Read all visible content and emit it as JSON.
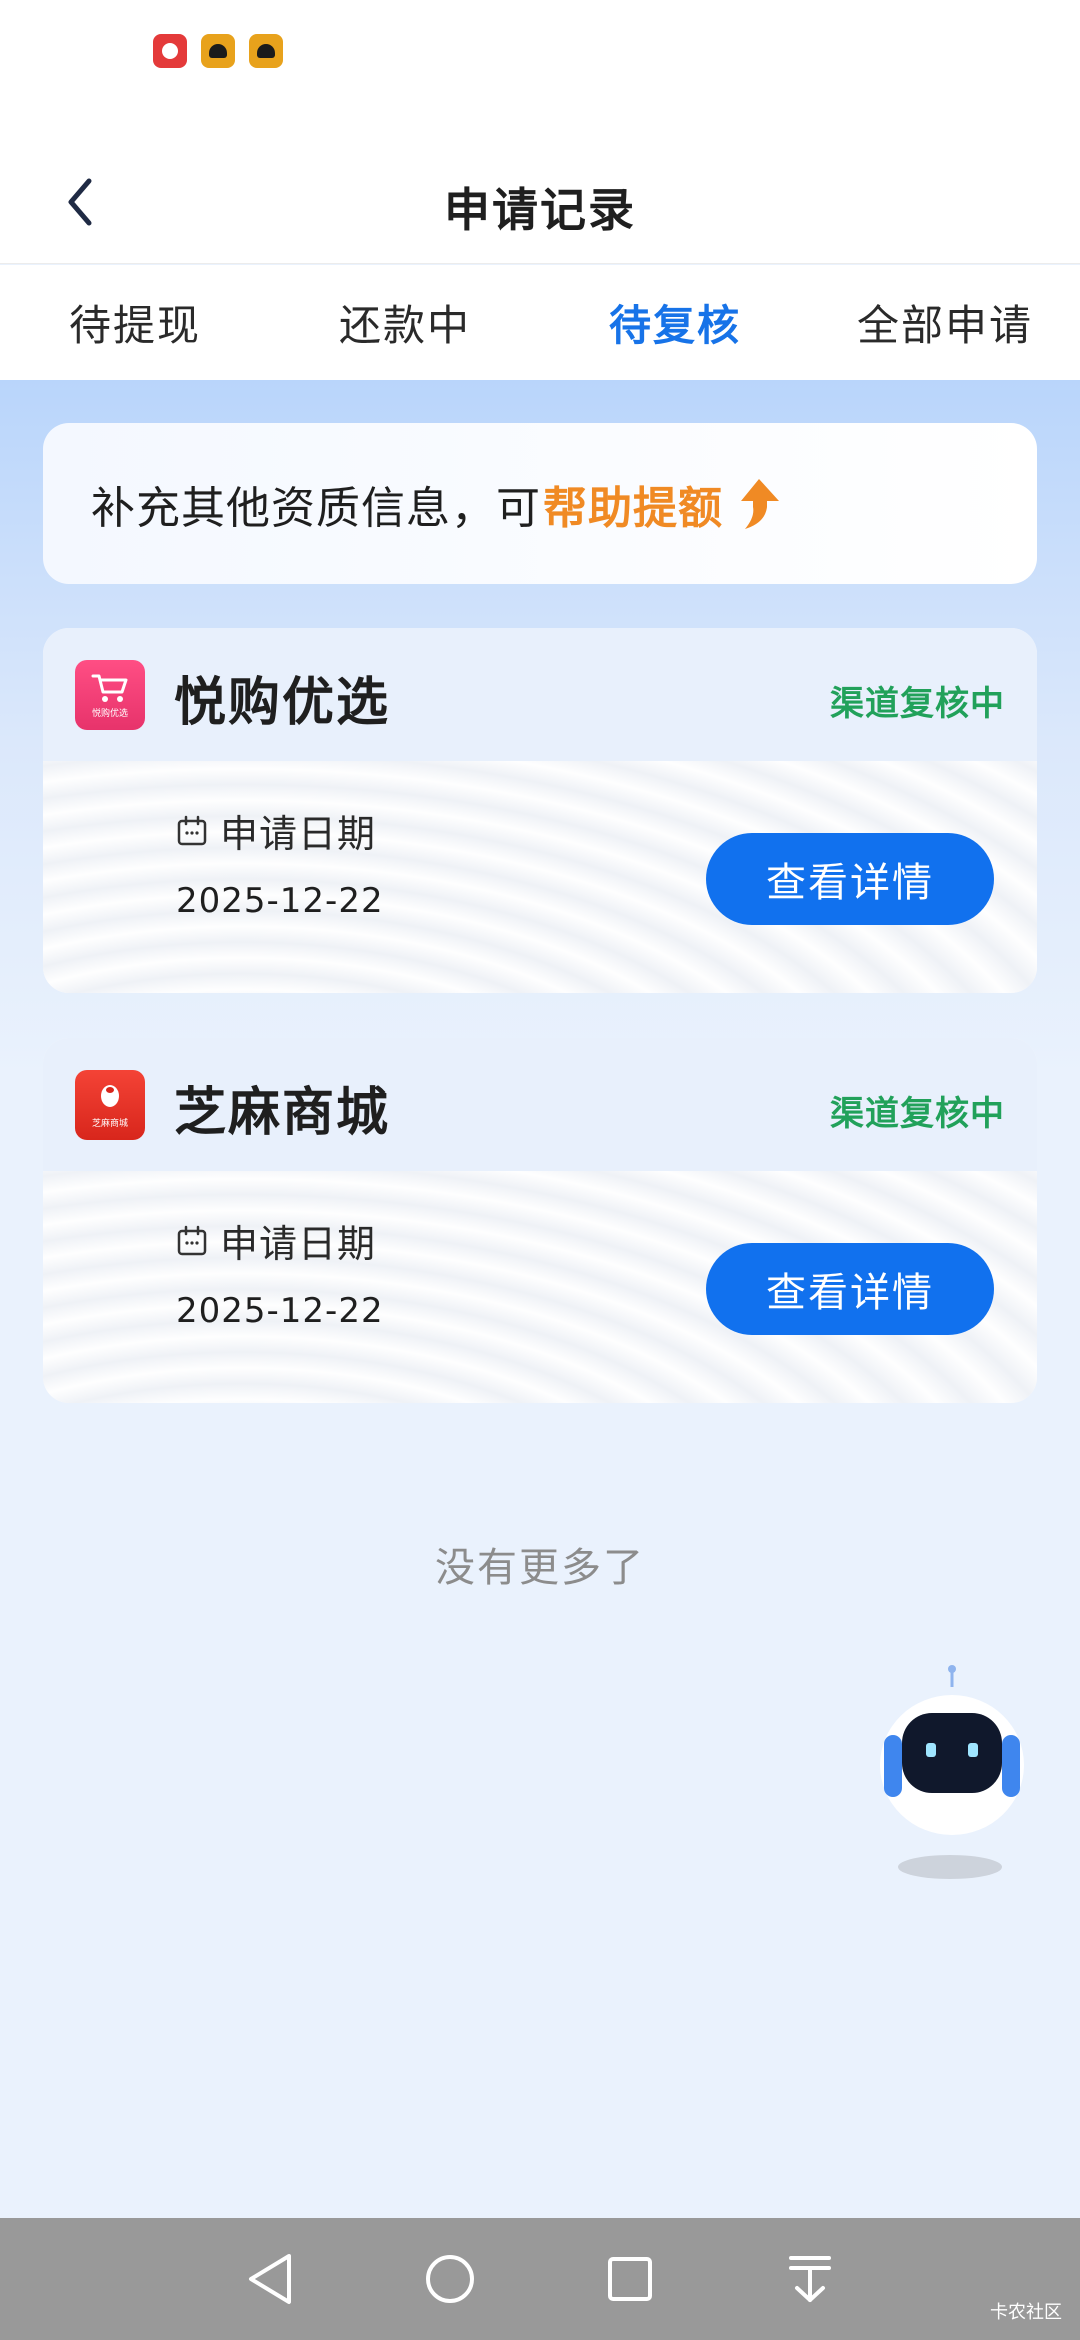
{
  "status_bar": {
    "icons": [
      "huawei-icon",
      "app-icon",
      "app-icon"
    ]
  },
  "header": {
    "title": "申请记录"
  },
  "tabs": [
    {
      "label": "待提现",
      "active": false
    },
    {
      "label": "还款中",
      "active": false
    },
    {
      "label": "待复核",
      "active": true
    },
    {
      "label": "全部申请",
      "active": false
    }
  ],
  "banner": {
    "text": "补充其他资质信息，可",
    "highlight": "帮助提额"
  },
  "cards": [
    {
      "app_name": "悦购优选",
      "logo_caption": "悦购优选",
      "status": "渠道复核中",
      "date_label": "申请日期",
      "date": "2025-12-22",
      "button": "查看详情"
    },
    {
      "app_name": "芝麻商城",
      "logo_caption": "芝麻商城",
      "status": "渠道复核中",
      "date_label": "申请日期",
      "date": "2025-12-22",
      "button": "查看详情"
    }
  ],
  "footer": {
    "no_more": "没有更多了"
  },
  "watermark": "卡农社区",
  "colors": {
    "accent": "#1171ee",
    "active_tab": "#1773e8",
    "highlight": "#f08a24",
    "status": "#21a15a"
  }
}
